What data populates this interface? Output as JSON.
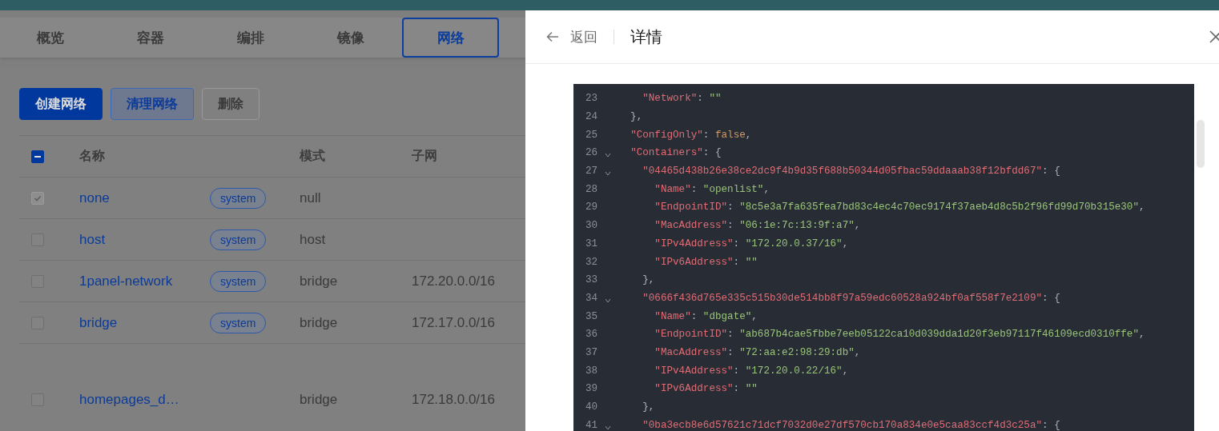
{
  "tabs": [
    {
      "label": "概览",
      "selected": false
    },
    {
      "label": "容器",
      "selected": false
    },
    {
      "label": "编排",
      "selected": false
    },
    {
      "label": "镜像",
      "selected": false
    },
    {
      "label": "网络",
      "selected": true
    }
  ],
  "toolbar": [
    {
      "label": "创建网络",
      "kind": "primary"
    },
    {
      "label": "清理网络",
      "kind": "secondary"
    },
    {
      "label": "删除",
      "kind": "plain"
    }
  ],
  "table": {
    "header_indeterminate": true,
    "columns": [
      "名称",
      "模式",
      "子网"
    ],
    "rows": [
      {
        "name": "none",
        "tag": "system",
        "mode": "null",
        "subnet": "",
        "checked": true,
        "disabled": true
      },
      {
        "name": "host",
        "tag": "system",
        "mode": "host",
        "subnet": "",
        "checked": false,
        "disabled": false
      },
      {
        "name": "1panel-network",
        "tag": "system",
        "mode": "bridge",
        "subnet": "172.20.0.0/16",
        "checked": false,
        "disabled": false
      },
      {
        "name": "bridge",
        "tag": "system",
        "mode": "bridge",
        "subnet": "172.17.0.0/16",
        "checked": false,
        "disabled": false
      },
      {
        "name": "homepages_d…",
        "tag": "",
        "mode": "bridge",
        "subnet": "172.18.0.0/16",
        "checked": false,
        "disabled": false,
        "tall": true
      }
    ]
  },
  "drawer": {
    "back": "返回",
    "title": "详情",
    "code": [
      {
        "number": "23",
        "foldable": false,
        "text": "    \"Network\": \"\""
      },
      {
        "number": "24",
        "foldable": false,
        "text": "  },"
      },
      {
        "number": "25",
        "foldable": false,
        "text": "  \"ConfigOnly\": false,"
      },
      {
        "number": "26",
        "foldable": true,
        "text": "  \"Containers\": {"
      },
      {
        "number": "27",
        "foldable": true,
        "text": "    \"04465d438b26e38ce2dc9f4b9d35f688b50344d05fbac59ddaaab38f12bfdd67\": {"
      },
      {
        "number": "28",
        "foldable": false,
        "text": "      \"Name\": \"openlist\","
      },
      {
        "number": "29",
        "foldable": false,
        "text": "      \"EndpointID\": \"8c5e3a7fa635fea7bd83c4ec4c70ec9174f37aeb4d8c5b2f96fd99d70b315e30\","
      },
      {
        "number": "30",
        "foldable": false,
        "text": "      \"MacAddress\": \"06:1e:7c:13:9f:a7\","
      },
      {
        "number": "31",
        "foldable": false,
        "text": "      \"IPv4Address\": \"172.20.0.37/16\","
      },
      {
        "number": "32",
        "foldable": false,
        "text": "      \"IPv6Address\": \"\""
      },
      {
        "number": "33",
        "foldable": false,
        "text": "    },"
      },
      {
        "number": "34",
        "foldable": true,
        "text": "    \"0666f436d765e335c515b30de514bb8f97a59edc60528a924bf0af558f7e2109\": {"
      },
      {
        "number": "35",
        "foldable": false,
        "text": "      \"Name\": \"dbgate\","
      },
      {
        "number": "36",
        "foldable": false,
        "text": "      \"EndpointID\": \"ab687b4cae5fbbe7eeb05122ca10d039dda1d20f3eb97117f46109ecd0310ffe\","
      },
      {
        "number": "37",
        "foldable": false,
        "text": "      \"MacAddress\": \"72:aa:e2:98:29:db\","
      },
      {
        "number": "38",
        "foldable": false,
        "text": "      \"IPv4Address\": \"172.20.0.22/16\","
      },
      {
        "number": "39",
        "foldable": false,
        "text": "      \"IPv6Address\": \"\""
      },
      {
        "number": "40",
        "foldable": false,
        "text": "    },"
      },
      {
        "number": "41",
        "foldable": true,
        "text": "    \"0ba3ecb8e6d57621c71dcf7032d0e27df570cb170a834e0e5caa83ccf4d3c25a\": {"
      }
    ]
  }
}
